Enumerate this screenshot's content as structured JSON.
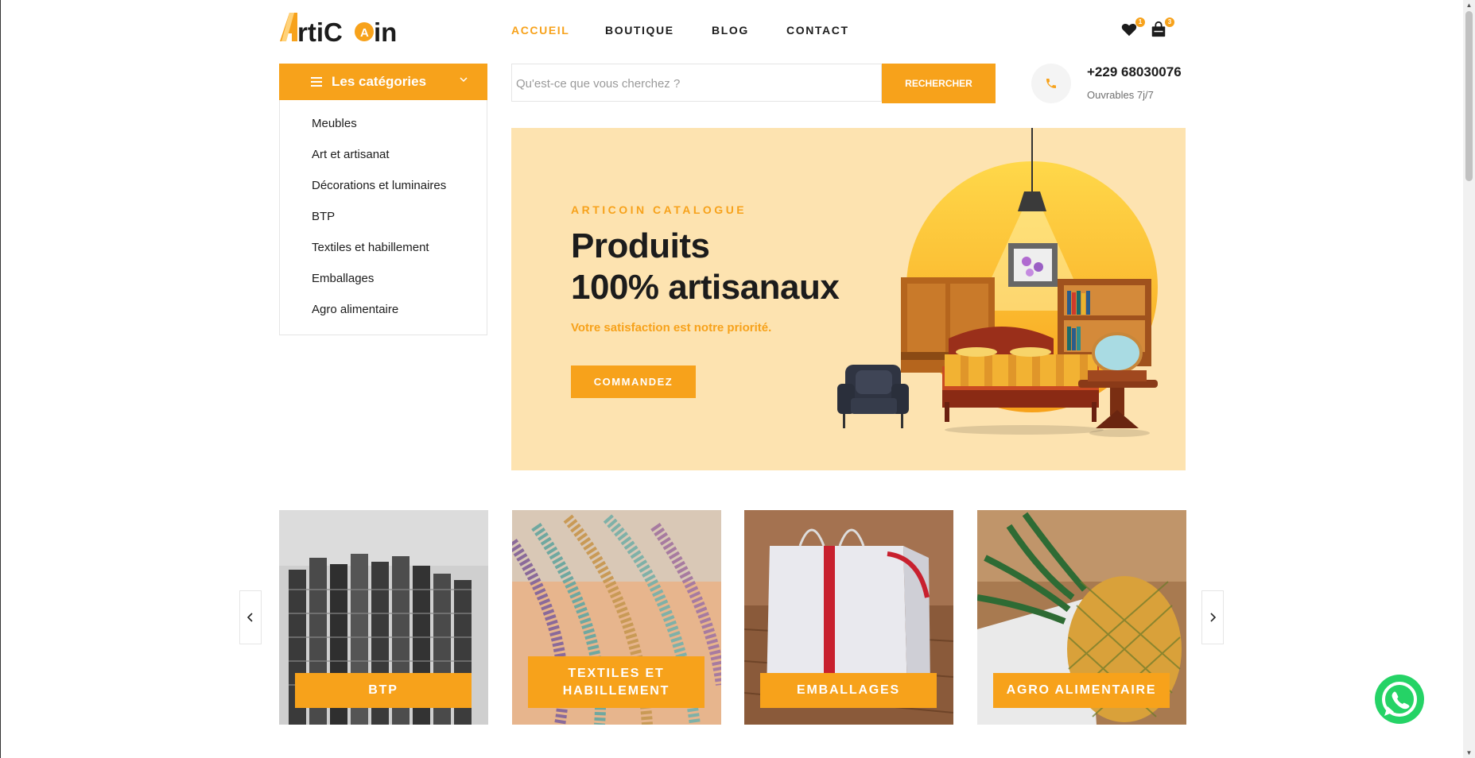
{
  "brand": {
    "name": "ArtiCoin",
    "colors": {
      "accent": "#f7a21b",
      "hero_bg": "#fde3b0",
      "text": "#1c1c1c",
      "whatsapp": "#25d366"
    }
  },
  "nav": {
    "items": [
      {
        "label": "ACCUEIL",
        "active": true
      },
      {
        "label": "BOUTIQUE",
        "active": false
      },
      {
        "label": "BLOG",
        "active": false
      },
      {
        "label": "CONTACT",
        "active": false
      }
    ]
  },
  "header_icons": {
    "wishlist": {
      "icon": "heart-icon",
      "count": "1"
    },
    "cart": {
      "icon": "shopping-bag-icon",
      "count": "3"
    }
  },
  "categories": {
    "title": "Les catégories",
    "items": [
      "Meubles",
      "Art et artisanat",
      "Décorations et luminaires",
      "BTP",
      "Textiles et habillement",
      "Emballages",
      "Agro alimentaire"
    ]
  },
  "search": {
    "placeholder": "Qu'est-ce que vous cherchez ?",
    "button_label": "RECHERCHER"
  },
  "contact": {
    "phone": "+229 68030076",
    "hours": "Ouvrables 7j/7"
  },
  "hero": {
    "kicker": "ARTICOIN CATALOGUE",
    "title_line1": "Produits",
    "title_line2": "100% artisanaux",
    "subtitle": "Votre satisfaction est notre priorité.",
    "cta": "COMMANDEZ"
  },
  "carousel": {
    "prev_icon": "chevron-left-icon",
    "next_icon": "chevron-right-icon",
    "cards": [
      {
        "label": "BTP"
      },
      {
        "label_line1": "TEXTILES ET",
        "label_line2": "HABILLEMENT"
      },
      {
        "label": "EMBALLAGES"
      },
      {
        "label": "AGRO ALIMENTAIRE"
      }
    ]
  }
}
